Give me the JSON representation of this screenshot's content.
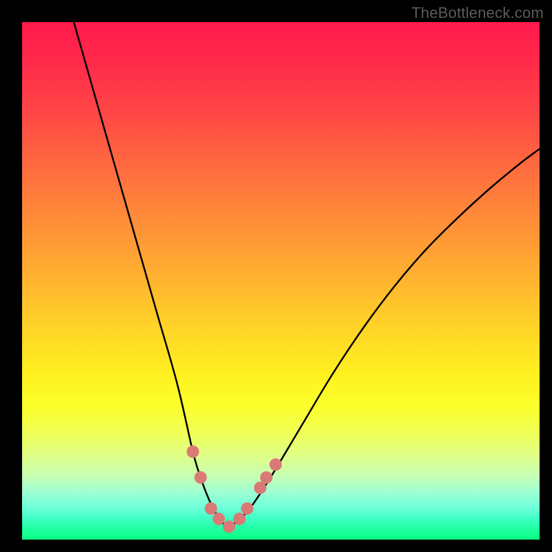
{
  "watermark": {
    "text": "TheBottleneck.com"
  },
  "chart_data": {
    "type": "line",
    "title": "",
    "xlabel": "",
    "ylabel": "",
    "xlim": [
      0,
      100
    ],
    "ylim": [
      0,
      100
    ],
    "grid": false,
    "background": "vertical-gradient red→green",
    "series": [
      {
        "name": "bottleneck-curve",
        "color": "#000000",
        "x": [
          10,
          14,
          18,
          22,
          26,
          30,
          33,
          34.5,
          36,
          37.5,
          39,
          40,
          41.5,
          44,
          48,
          54,
          60,
          66,
          72,
          78,
          84,
          90,
          96,
          100
        ],
        "y": [
          100,
          86,
          72,
          58,
          44,
          30,
          17,
          12,
          8,
          5,
          3,
          2.5,
          3.5,
          6,
          12,
          22,
          32,
          41,
          49,
          56,
          62,
          67.5,
          72.5,
          75.5
        ]
      }
    ],
    "markers": [
      {
        "name": "left-cluster-top",
        "x": 33.0,
        "y": 17.0
      },
      {
        "name": "left-cluster-lower",
        "x": 34.5,
        "y": 12.0
      },
      {
        "name": "trough-left-a",
        "x": 36.5,
        "y": 6.0
      },
      {
        "name": "trough-left-b",
        "x": 38.0,
        "y": 4.0
      },
      {
        "name": "trough-min",
        "x": 40.0,
        "y": 2.5
      },
      {
        "name": "trough-right-a",
        "x": 42.0,
        "y": 4.0
      },
      {
        "name": "trough-right-b",
        "x": 43.5,
        "y": 6.0
      },
      {
        "name": "right-cluster-a",
        "x": 46.0,
        "y": 10.0
      },
      {
        "name": "right-cluster-b",
        "x": 47.2,
        "y": 12.0
      },
      {
        "name": "right-cluster-c",
        "x": 49.0,
        "y": 14.5
      }
    ],
    "marker_style": {
      "color": "#d97a77",
      "radius_px": 9
    }
  }
}
